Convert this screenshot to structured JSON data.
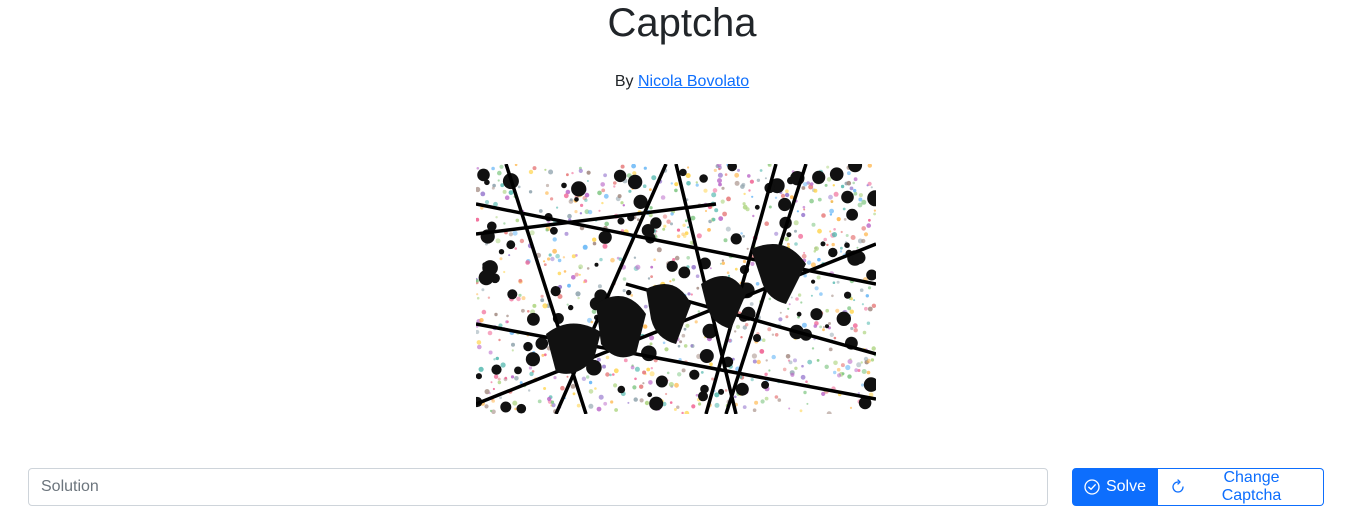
{
  "header": {
    "title": "Captcha",
    "by_prefix": "By",
    "author_link": "Nicola Bovolato"
  },
  "captcha": {
    "image_name": "captcha-image"
  },
  "form": {
    "solution_placeholder": "Solution",
    "solution_value": "",
    "solve_label": "Solve",
    "change_label": "Change Captcha"
  },
  "colors": {
    "primary": "#0d6efd",
    "text": "#212529"
  }
}
